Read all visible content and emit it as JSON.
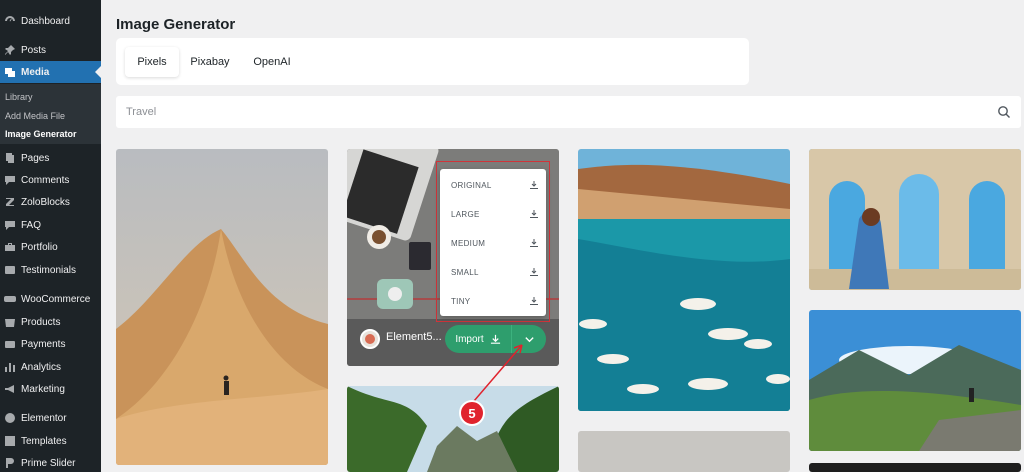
{
  "sidebar": {
    "items": [
      {
        "label": "Dashboard",
        "icon": "dashboard-icon"
      },
      {
        "label": "Posts",
        "icon": "pin-icon"
      },
      {
        "label": "Media",
        "icon": "media-icon"
      },
      {
        "label": "Pages",
        "icon": "pages-icon"
      },
      {
        "label": "Comments",
        "icon": "comments-icon"
      },
      {
        "label": "ZoloBlocks",
        "icon": "zoloblocks-icon"
      },
      {
        "label": "FAQ",
        "icon": "faq-icon"
      },
      {
        "label": "Portfolio",
        "icon": "portfolio-icon"
      },
      {
        "label": "Testimonials",
        "icon": "testimonials-icon"
      },
      {
        "label": "WooCommerce",
        "icon": "woocommerce-icon"
      },
      {
        "label": "Products",
        "icon": "products-icon"
      },
      {
        "label": "Payments",
        "icon": "payments-icon"
      },
      {
        "label": "Analytics",
        "icon": "analytics-icon"
      },
      {
        "label": "Marketing",
        "icon": "marketing-icon"
      },
      {
        "label": "Elementor",
        "icon": "elementor-icon"
      },
      {
        "label": "Templates",
        "icon": "templates-icon"
      },
      {
        "label": "Prime Slider",
        "icon": "prime-slider-icon"
      }
    ],
    "submenu": [
      "Library",
      "Add Media File",
      "Image Generator"
    ]
  },
  "main": {
    "title": "Image Generator",
    "tabs": [
      "Pixels",
      "Pixabay",
      "OpenAI"
    ],
    "search": {
      "value": "Travel"
    }
  },
  "card": {
    "name": "Element5...",
    "import_label": "Import",
    "sizes": [
      "ORIGINAL",
      "LARGE",
      "MEDIUM",
      "SMALL",
      "TINY"
    ]
  },
  "annotation": {
    "step": "5"
  },
  "colors": {
    "accent": "#2271b1",
    "import": "#2e9e6d",
    "highlight": "#d0343a"
  }
}
